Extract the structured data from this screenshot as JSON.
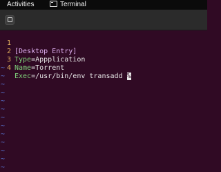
{
  "topbar": {
    "activities": "Activities",
    "app_name": "Terminal",
    "app_icon": "terminal-icon"
  },
  "toolbar": {
    "new_tab_icon": "new-tab-icon"
  },
  "editor": {
    "lines": [
      {
        "number": "1",
        "text": "[Desktop Entry]"
      },
      {
        "number": "2",
        "key": "Type",
        "value": "Appplication"
      },
      {
        "number": "3",
        "key": "Name",
        "value": "Torrent"
      },
      {
        "number": "4",
        "key": "Exec",
        "value": "/usr/bin/env transadd ",
        "cursor_char": "%"
      }
    ],
    "empty_line_marker": "~",
    "equals": "="
  },
  "colors": {
    "background": "#300a24",
    "line_number": "#e5b15e",
    "section": "#e0b0f2",
    "key": "#7fd27a",
    "tilde": "#5a78d9"
  }
}
